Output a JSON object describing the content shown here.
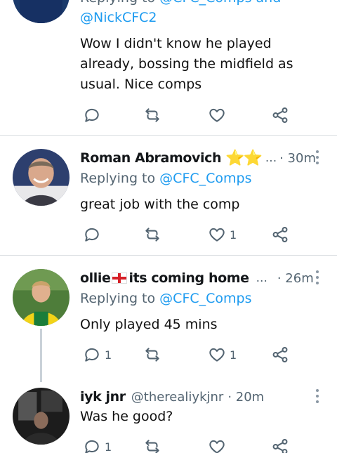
{
  "top_tweet": {
    "reply_prefix": "Replying to",
    "reply_users": "@CFC_Comps and",
    "reply_users_2": "@NickCFC2",
    "text": "Wow I didn't know he played already, bossing the midfield as usual. Nice comps"
  },
  "tweets": [
    {
      "name": "Roman Abramovich",
      "name_suffix": "⭐⭐",
      "ellipsis": "...",
      "time": "· 30m",
      "reply_prefix": "Replying to",
      "reply_user": "@CFC_Comps",
      "text": "great job with the comp",
      "reply_count": "",
      "like_count": "1"
    },
    {
      "name": "ollie",
      "name_suffix": "its coming home",
      "ellipsis": "...",
      "time": "· 26m",
      "reply_prefix": "Replying to",
      "reply_user": "@CFC_Comps",
      "text": "Only played 45 mins",
      "reply_count": "1",
      "like_count": "1"
    },
    {
      "name": "iyk jnr",
      "handle": "@therealiykjnr",
      "time": "· 20m",
      "text": "Was he good?",
      "reply_count": "1",
      "like_count": ""
    }
  ],
  "colors": {
    "link": "#1d9bf0",
    "muted": "#536471",
    "star": "#f5c518"
  }
}
